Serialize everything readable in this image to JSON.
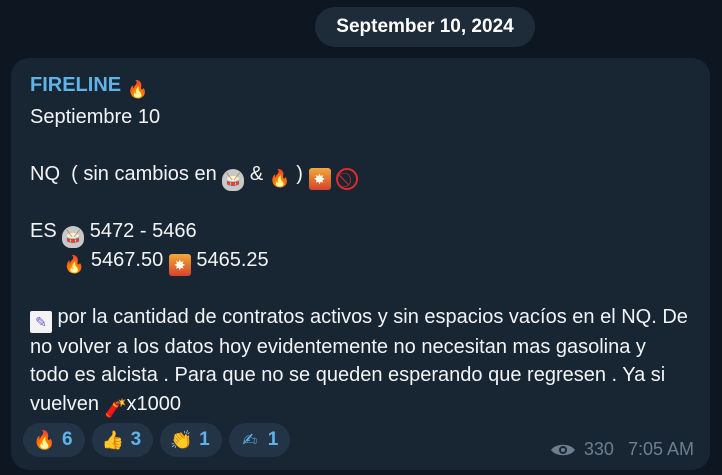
{
  "date_separator": "September 10, 2024",
  "message": {
    "sender": "FIRELINE",
    "sender_emoji": "🔥",
    "line_date": "Septiembre 10",
    "nq_prefix": "NQ  ( sin cambios en ",
    "nq_amp": " & ",
    "nq_close": " ) ",
    "es_prefix": "ES ",
    "es_range": " 5472 - 5466",
    "es_level1": " 5467.50 ",
    "es_level2": " 5465.25",
    "note_text": " por la cantidad de contratos activos y sin espacios vacíos en el NQ. De no volver a los datos hoy evidentemente no necesitan mas gasolina y todo es alcista . Para que no se queden esperando que regresen . Ya si vuelven ",
    "note_suffix": "x1000"
  },
  "reactions": [
    {
      "emoji": "🔥",
      "count": "6"
    },
    {
      "emoji": "👍",
      "count": "3"
    },
    {
      "emoji": "👏",
      "count": "1"
    },
    {
      "emoji": "✍",
      "count": "1"
    }
  ],
  "meta": {
    "views": "330",
    "time": "7:05 AM"
  },
  "colors": {
    "background": "#0e1621",
    "bubble": "#182533",
    "sender": "#5fb3e8",
    "text": "#f2f4f6",
    "meta": "#6d7f8f"
  },
  "icons": [
    "fire-icon",
    "drum-icon",
    "collision-icon",
    "prohibited-icon",
    "memo-icon",
    "firecracker-icon",
    "eye-icon"
  ]
}
